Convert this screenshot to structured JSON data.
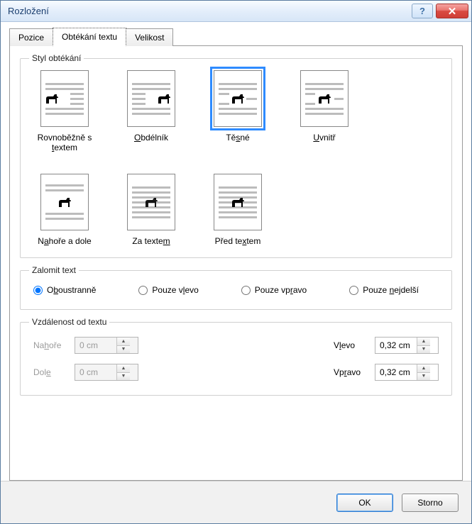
{
  "title": "Rozložení",
  "tabs": {
    "position": "Pozice",
    "wrapping": "Obtékání textu",
    "size": "Velikost"
  },
  "groups": {
    "wrapStyle": "Styl obtékání",
    "wrapText": "Zalomit text",
    "distance": "Vzdálenost od textu"
  },
  "wrapStyles": {
    "inline": {
      "label_pre": "Rovnoběžně s ",
      "label_u": "t",
      "label_post": "extem"
    },
    "square": {
      "label_pre": "",
      "label_u": "O",
      "label_post": "bdélník"
    },
    "tight": {
      "label_pre": "Tě",
      "label_u": "s",
      "label_post": "né"
    },
    "through": {
      "label_pre": "",
      "label_u": "U",
      "label_post": "vnitř"
    },
    "topbot": {
      "label_pre": "N",
      "label_u": "a",
      "label_post": "hoře a dole"
    },
    "behind": {
      "label_pre": "Za texte",
      "label_u": "m",
      "label_post": ""
    },
    "front": {
      "label_pre": "Před te",
      "label_u": "x",
      "label_post": "tem"
    }
  },
  "radios": {
    "both": {
      "pre": "O",
      "u": "b",
      "post": "oustranně"
    },
    "left": {
      "pre": "Pouze v",
      "u": "l",
      "post": "evo"
    },
    "right": {
      "pre": "Pouze vp",
      "u": "r",
      "post": "avo"
    },
    "largest": {
      "pre": "Pouze ",
      "u": "n",
      "post": "ejdelší"
    }
  },
  "distance": {
    "topLabel": {
      "pre": "Na",
      "u": "h",
      "post": "oře"
    },
    "bottomLabel": {
      "pre": "Dol",
      "u": "e",
      "post": ""
    },
    "leftLabel": {
      "pre": "V",
      "u": "l",
      "post": "evo"
    },
    "rightLabel": {
      "pre": "Vp",
      "u": "r",
      "post": "avo"
    },
    "top": "0 cm",
    "bottom": "0 cm",
    "left": "0,32 cm",
    "right": "0,32 cm"
  },
  "buttons": {
    "ok": "OK",
    "cancel": "Storno"
  }
}
